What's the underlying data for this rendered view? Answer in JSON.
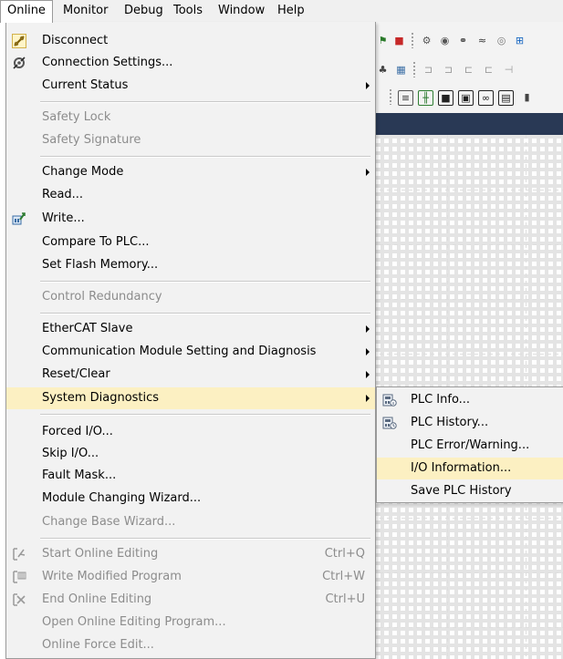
{
  "menubar": {
    "items": [
      "Online",
      "Monitor",
      "Debug",
      "Tools",
      "Window",
      "Help"
    ],
    "open_item": "Online"
  },
  "menu": {
    "items": [
      {
        "label": "Disconnect",
        "icon": "disconnect-plug-icon",
        "enabled": true
      },
      {
        "label": "Connection Settings...",
        "icon": "connection-settings-icon",
        "enabled": true
      },
      {
        "label": "Current Status",
        "enabled": true,
        "submenu": true
      },
      {
        "label": "Safety Lock",
        "enabled": false
      },
      {
        "label": "Safety Signature",
        "enabled": false
      },
      {
        "label": "Change Mode",
        "enabled": true,
        "submenu": true
      },
      {
        "label": "Read...",
        "enabled": true
      },
      {
        "label": "Write...",
        "icon": "write-plc-icon",
        "enabled": true
      },
      {
        "label": "Compare To PLC...",
        "enabled": true
      },
      {
        "label": "Set Flash Memory...",
        "enabled": true
      },
      {
        "label": "Control Redundancy",
        "enabled": false
      },
      {
        "label": "EtherCAT Slave",
        "enabled": true,
        "submenu": true
      },
      {
        "label": "Communication Module Setting and Diagnosis",
        "enabled": true,
        "submenu": true
      },
      {
        "label": "Reset/Clear",
        "enabled": true,
        "submenu": true
      },
      {
        "label": "System Diagnostics",
        "enabled": true,
        "submenu": true,
        "highlighted": true
      },
      {
        "label": "Forced I/O...",
        "enabled": true
      },
      {
        "label": "Skip I/O...",
        "enabled": true
      },
      {
        "label": "Fault Mask...",
        "enabled": true
      },
      {
        "label": "Module Changing Wizard...",
        "enabled": true
      },
      {
        "label": "Change Base Wizard...",
        "enabled": false
      },
      {
        "label": "Start Online Editing",
        "shortcut": "Ctrl+Q",
        "icon": "start-online-edit-icon",
        "enabled": false
      },
      {
        "label": "Write Modified Program",
        "shortcut": "Ctrl+W",
        "icon": "write-modified-icon",
        "enabled": false
      },
      {
        "label": "End Online Editing",
        "shortcut": "Ctrl+U",
        "icon": "end-online-edit-icon",
        "enabled": false
      },
      {
        "label": "Open Online Editing Program...",
        "enabled": false
      },
      {
        "label": "Online Force Edit...",
        "enabled": false
      }
    ]
  },
  "submenu": {
    "items": [
      {
        "label": "PLC Info...",
        "icon": "plc-info-icon"
      },
      {
        "label": "PLC History...",
        "icon": "plc-history-icon"
      },
      {
        "label": "PLC Error/Warning..."
      },
      {
        "label": "I/O Information...",
        "highlighted": true
      },
      {
        "label": "Save PLC History"
      }
    ]
  },
  "colors": {
    "highlight": "#fcf0c2",
    "menu_bg": "#f2f2f2",
    "disabled_text": "#8c8c8c",
    "dark_header": "#293955"
  }
}
